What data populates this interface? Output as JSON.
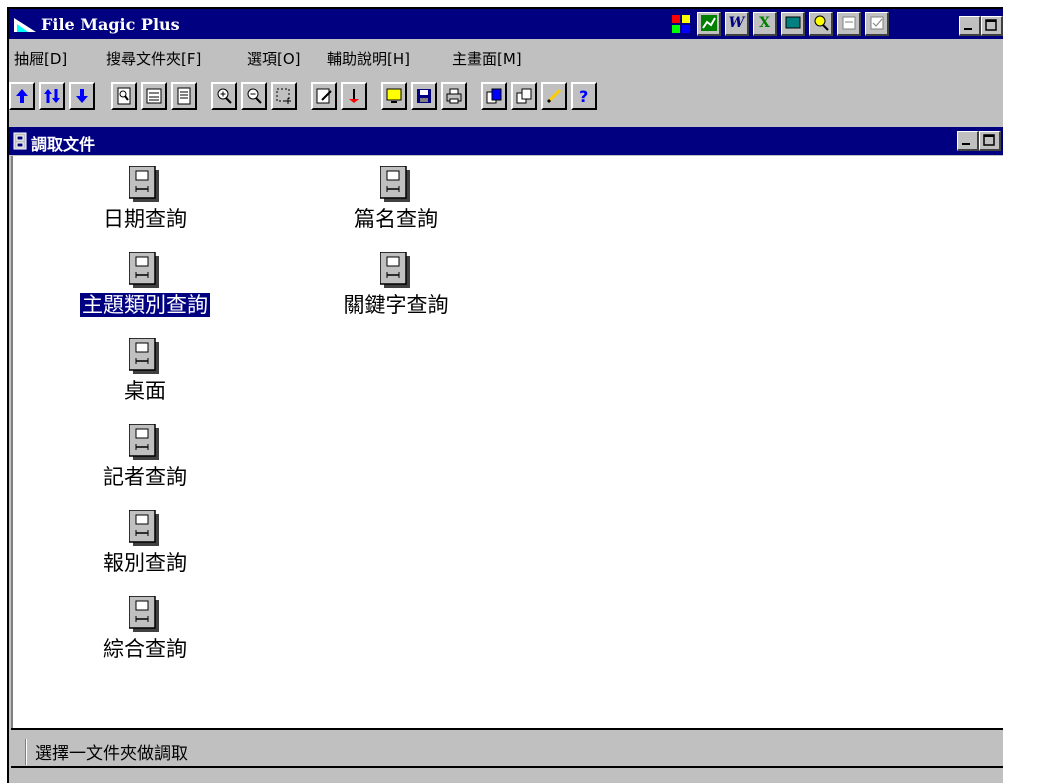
{
  "window": {
    "title": "File Magic Plus"
  },
  "tray_icons": [
    "grid-icon",
    "chart-icon",
    "word-icon",
    "excel-icon",
    "monitor-icon",
    "search-icon",
    "print-preview-icon",
    "check-icon"
  ],
  "menu": [
    "抽屜[D]",
    "搜尋文件夾[F]",
    "選項[O]",
    "輔助說明[H]",
    "主畫面[M]"
  ],
  "toolbar": [
    "arrow-up-icon",
    "arrows-updown-icon",
    "arrow-down-icon",
    "page-view-icon",
    "page-swap-icon",
    "page-text-icon",
    "zoom-in-icon",
    "zoom-out-icon",
    "select-region-icon",
    "edit-icon",
    "pin-icon",
    "monitor-icon",
    "save-icon",
    "print-icon",
    "transfer-icon",
    "copy-icon",
    "pencil-icon",
    "help-icon"
  ],
  "child_window": {
    "title": "調取文件"
  },
  "drawers": {
    "date": "日期查詢",
    "title": "篇名查詢",
    "subject": "主題類別查詢",
    "keyword": "關鍵字查詢",
    "desktop": "桌面",
    "reporter": "記者查詢",
    "paper": "報別查詢",
    "combined": "綜合查詢"
  },
  "status_bar": {
    "text": "選擇一文件夾做調取"
  },
  "colors": {
    "titlebar": "#000080",
    "face": "#c0c0c0",
    "selection": "#000080"
  }
}
